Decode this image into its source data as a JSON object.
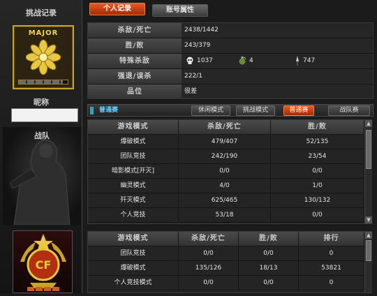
{
  "sidebar": {
    "title": "挑战记录",
    "rank": "MAJOR",
    "nickname_label": "昵称",
    "nickname": "",
    "clan_label": "战队",
    "progress": 0.9
  },
  "tabs": {
    "personal": "个人记录",
    "account": "账号属性"
  },
  "summary": {
    "kd_label": "杀敌/死亡",
    "kd_value": "2438/1442",
    "wl_label": "胜/败",
    "wl_value": "243/379",
    "special_label": "特殊杀敌",
    "headshot": "1037",
    "grenade": "4",
    "knife": "747",
    "escape_label": "强退/误杀",
    "escape_value": "222/1",
    "rating_label": "品位",
    "rating_value": "很差"
  },
  "mode_bar": {
    "current": "普通赛",
    "buttons": [
      "休闲模式",
      "挑战模式",
      "普通赛",
      "战队赛"
    ],
    "active_index": 2
  },
  "mode_table": {
    "headers": [
      "游戏模式",
      "杀敌/死亡",
      "胜/败"
    ],
    "rows": [
      [
        "爆破模式",
        "479/407",
        "52/135"
      ],
      [
        "团队竞技",
        "242/190",
        "23/54"
      ],
      [
        "暗影模式[开灭]",
        "0/0",
        "0/0"
      ],
      [
        "幽灵模式",
        "4/0",
        "1/0"
      ],
      [
        "歼灭模式",
        "625/465",
        "130/132"
      ],
      [
        "个人竞技",
        "53/18",
        "0/0"
      ]
    ]
  },
  "rank_table": {
    "headers": [
      "游戏模式",
      "杀敌/死亡",
      "胜/败",
      "排行"
    ],
    "rows": [
      [
        "团队竞技",
        "0/0",
        "0/0",
        "0"
      ],
      [
        "爆破模式",
        "135/126",
        "18/13",
        "53821"
      ],
      [
        "个人竞技模式",
        "0/0",
        "0/0",
        "0"
      ]
    ]
  }
}
